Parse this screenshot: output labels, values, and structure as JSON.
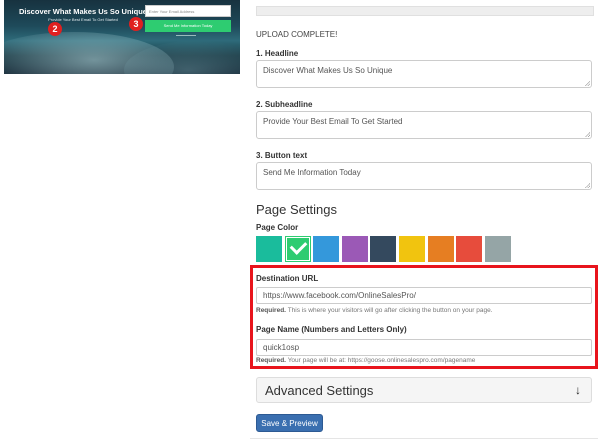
{
  "preview": {
    "headline": "Discover What Makes Us So Unique",
    "subheadline": "Provide Your Best Email To Get Started",
    "email_placeholder": "Enter Your Email Address",
    "button_label": "Send Me Information Today",
    "markers": [
      "2",
      "3"
    ]
  },
  "upload_status": "UPLOAD COMPLETE!",
  "fields": {
    "headline": {
      "label": "1. Headline",
      "value": "Discover What Makes Us So Unique"
    },
    "subheadline": {
      "label": "2. Subheadline",
      "value": "Provide Your Best Email To Get Started"
    },
    "button_text": {
      "label": "3. Button text",
      "value": "Send Me Information Today"
    }
  },
  "page_settings": {
    "title": "Page Settings",
    "page_color_label": "Page Color",
    "swatches": [
      "#1abc9c",
      "#2ecc71",
      "#3498db",
      "#9b59b6",
      "#34495e",
      "#f1c40f",
      "#e67e22",
      "#e74c3c",
      "#95a5a6"
    ],
    "selected_index": 1
  },
  "destination": {
    "label": "Destination URL",
    "value": "https://www.facebook.com/OnlineSalesPro/",
    "help_required": "Required.",
    "help_text": "This is where your visitors will go after clicking the button on your page."
  },
  "page_name": {
    "label": "Page Name (Numbers and Letters Only)",
    "value": "quick1osp",
    "help_required": "Required.",
    "help_text": "Your page will be at: https://goose.onlinesalespro.com/pagename"
  },
  "advanced": {
    "title": "Advanced Settings",
    "icon": "arrow-down-icon"
  },
  "save_label": "Save & Preview",
  "colors": {
    "highlight": "#e8141c",
    "primary_button": "#3a6fb0"
  }
}
